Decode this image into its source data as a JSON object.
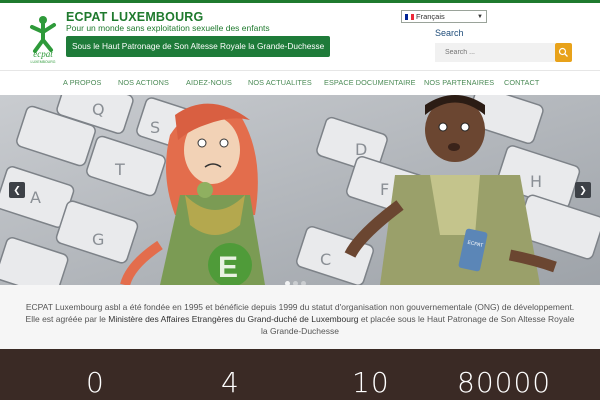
{
  "site": {
    "title": "ECPAT LUXEMBOURG",
    "tagline": "Pour un monde sans exploitation sexuelle des enfants",
    "patronage": "Sous le Haut Patronage de Son Altesse Royale la Grande-Duchesse",
    "logo_text": "ecpat",
    "logo_subtext": "LUXEMBOURG"
  },
  "language": {
    "selected": "Français"
  },
  "search": {
    "label": "Search",
    "placeholder": "Search ..."
  },
  "nav": {
    "items": [
      {
        "label": "A PROPOS"
      },
      {
        "label": "NOS ACTIONS"
      },
      {
        "label": "AIDEZ-NOUS"
      },
      {
        "label": "NOS ACTUALITES"
      },
      {
        "label": "ESPACE DOCUMENTAIRE"
      },
      {
        "label": "NOS PARTENAIRES"
      },
      {
        "label": "CONTACT"
      }
    ]
  },
  "slider": {
    "keys": [
      "Q",
      "S",
      "T",
      "A",
      "G",
      "H",
      "E",
      "D",
      "F",
      "C"
    ],
    "phone_text": "ECPAT"
  },
  "about": {
    "part1": "ECPAT Luxembourg asbl a été fondée en 1995 et bénéficie depuis 1999 du statut d'organisation non gouvernementale (ONG) de développement. Elle est agréée par le ",
    "ministry": "Ministère des Affaires Etrangères du Grand-duché de Luxembourg",
    "part2": " et placée sous le Haut Patronage de Son Altesse Royale la Grande-Duchesse"
  },
  "stats": [
    {
      "value": "0"
    },
    {
      "value": "4"
    },
    {
      "value": "10"
    },
    {
      "value": "80000"
    }
  ],
  "colors": {
    "brand_green": "#1f7a2e",
    "accent_orange": "#e8a21a",
    "stats_bg": "#3a2a25"
  }
}
